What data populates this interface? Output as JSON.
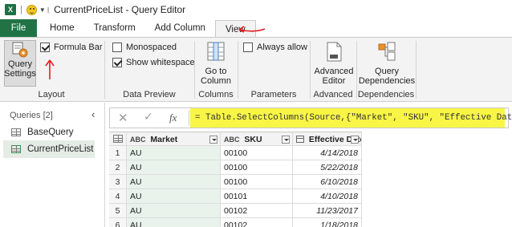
{
  "titlebar": {
    "app_icon": "X",
    "title": "CurrentPriceList - Query Editor"
  },
  "tabs": [
    {
      "label": "File"
    },
    {
      "label": "Home"
    },
    {
      "label": "Transform"
    },
    {
      "label": "Add Column"
    },
    {
      "label": "View"
    }
  ],
  "ribbon": {
    "layout": {
      "query_settings": "Query\nSettings",
      "formula_bar": "Formula Bar",
      "group": "Layout"
    },
    "data_preview": {
      "monospaced": "Monospaced",
      "show_whitespace": "Show whitespace",
      "group": "Data Preview"
    },
    "columns": {
      "go_to_column": "Go to\nColumn",
      "group": "Columns"
    },
    "parameters": {
      "always_allow": "Always allow",
      "group": "Parameters"
    },
    "advanced": {
      "advanced_editor": "Advanced\nEditor",
      "group": "Advanced"
    },
    "dependencies": {
      "query_dependencies": "Query\nDependencies",
      "group": "Dependencies"
    }
  },
  "queries": {
    "header": "Queries [2]",
    "items": [
      {
        "label": "BaseQuery"
      },
      {
        "label": "CurrentPriceList"
      }
    ]
  },
  "formula": {
    "text": "= Table.SelectColumns(Source,{\"Market\", \"SKU\", \"Effective Date\"})"
  },
  "grid": {
    "columns": [
      {
        "type": "ABC",
        "label": "Market"
      },
      {
        "type": "ABC",
        "label": "SKU"
      },
      {
        "type": "date",
        "label": "Effective Date"
      }
    ],
    "rows": [
      {
        "n": "1",
        "market": "AU",
        "sku": "00100",
        "date": "4/14/2018"
      },
      {
        "n": "2",
        "market": "AU",
        "sku": "00100",
        "date": "5/22/2018"
      },
      {
        "n": "3",
        "market": "AU",
        "sku": "00100",
        "date": "6/10/2018"
      },
      {
        "n": "4",
        "market": "AU",
        "sku": "00101",
        "date": "4/10/2018"
      },
      {
        "n": "5",
        "market": "AU",
        "sku": "00102",
        "date": "11/23/2017"
      },
      {
        "n": "6",
        "market": "AU",
        "sku": "00102",
        "date": "1/18/2018"
      }
    ]
  },
  "colors": {
    "accent": "#217346",
    "highlight": "#f8f547",
    "annotation": "#e02020"
  }
}
